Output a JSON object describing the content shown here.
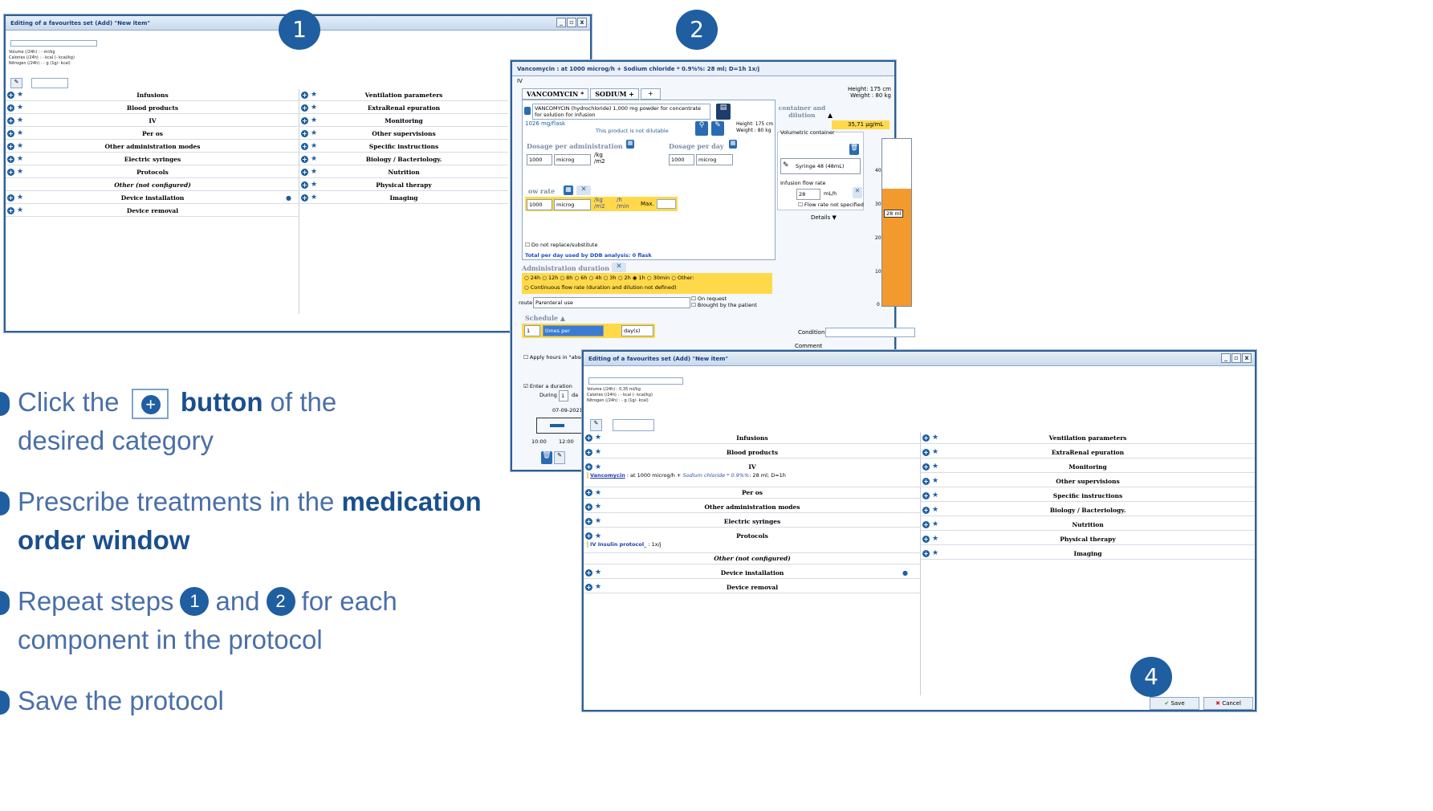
{
  "window1": {
    "title": "Editing of a favourites set (Add) \"New item\"",
    "info": [
      "Volume (/24h) : - ml/kg",
      "Calories (/24h) : - kcal (- kcal/kg)",
      "Nitrogen (/24h) : - g (1g/- kcal)"
    ],
    "left_cats": [
      "Infusions",
      "Blood products",
      "IV",
      "Per os",
      "Other administration modes",
      "Electric syringes",
      "Protocols",
      "Other (not configured)",
      "Device installation",
      "Device removal"
    ],
    "right_cats": [
      "Ventilation parameters",
      "ExtraRenal epuration",
      "Monitoring",
      "Other supervisions",
      "Specific instructions",
      "Biology / Bacteriology.",
      "Nutrition",
      "Physical therapy",
      "Imaging"
    ]
  },
  "window2": {
    "title": "Vancomycin : at 1000 microg/h + Sodium chloride * 0.9%%: 28 ml; D=1h 1x/j",
    "route_label": "IV",
    "height": "Height: 175 cm",
    "weight": "Weight : 80 kg",
    "tabs": [
      "VANCOMYCIN *",
      "SODIUM +",
      "+"
    ],
    "product": "VANCOMYCIN (hydrochloride) 1,000 mg powder for concentrate for solution for infusion",
    "conc": "1026 mg/flask",
    "not_dilutable": "This product is not dilutable",
    "height2": "Height: 175 cm",
    "weight2": "Weight : 80 kg",
    "container_label": "container and dilution",
    "ratio": "35,71 µg/mL",
    "dosage_admin": "Dosage per administration",
    "dosage_day": "Dosage per day",
    "dose_val": "1000",
    "dose_unit": "microg",
    "per_kg": "/kg /m2",
    "flow_rate": "ow rate",
    "flow_units": "/kg /m2",
    "flow_time": "/h /min",
    "max_label": "Max.",
    "vol_container": "Volumetric container",
    "syringe": "Syringe 48 (48mL)",
    "infusion_flow": "Infusion flow rate",
    "flow_val": "28",
    "flow_unit": "mL/h",
    "flow_not_spec": "Flow rate not specified",
    "details": "Details",
    "no_replace": "Do not replace/substitute",
    "total": "Total per day used by DDB analysis: 0 flask",
    "admin_duration": "Administration duration",
    "durations": [
      "24h",
      "12h",
      "8h",
      "6h",
      "4h",
      "3h",
      "2h",
      "1h",
      "30min",
      "Other:"
    ],
    "continuous": "Continuous flow rate (duration and dilution not defined)",
    "route": "route",
    "route_val": "Parenteral use",
    "on_request": "On request",
    "brought": "Brought by the patient",
    "schedule": "Schedule",
    "sched_n": "1",
    "times_per": "times per",
    "days": "day(s)",
    "condition": "Condition",
    "comment": "Comment",
    "apply_hours": "Apply hours in \"abso",
    "enter_duration": "Enter a duration",
    "during": "During",
    "during_val": "1",
    "da": "da",
    "date": "07-09-2021",
    "t1": "10:00",
    "t2": "12:00",
    "axis": [
      "40",
      "30",
      "20",
      "10",
      "0"
    ],
    "bar_label": "28 ml",
    "bar_fill": 0.7
  },
  "window3": {
    "title": "Editing of a favourites set (Add) \"New item\"",
    "info": [
      "Volume (/24h) : 0,35 ml/kg",
      "Calories (/24h) : - kcal (- kcal/kg)",
      "Nitrogen (/24h) : - g (1g/- kcal)"
    ],
    "vanc_drug": "Vancomycin",
    "vanc_rest": " : at 1000 microg/h + ",
    "vanc_sod": "Sodium chloride * 0.9%%",
    "vanc_end": ": 28 ml; D=1h",
    "insulin": "IV Insulin protocol_",
    "insulin_end": " : 1x/j",
    "save": "Save",
    "cancel": "Cancel"
  },
  "badges": [
    "1",
    "2",
    "4"
  ],
  "steps": {
    "s1_a": "Click the",
    "s1_b": "button",
    "s1_c": "of the",
    "s1_d": "desired category",
    "s2_a": "Prescribe treatments in the",
    "s2_b": "medication",
    "s2_c": "order window",
    "s3_a": "Repeat steps",
    "s3_n1": "1",
    "s3_and": "and",
    "s3_n2": "2",
    "s3_b": "for each",
    "s3_c": "component in the protocol",
    "s4": "Save the protocol"
  }
}
